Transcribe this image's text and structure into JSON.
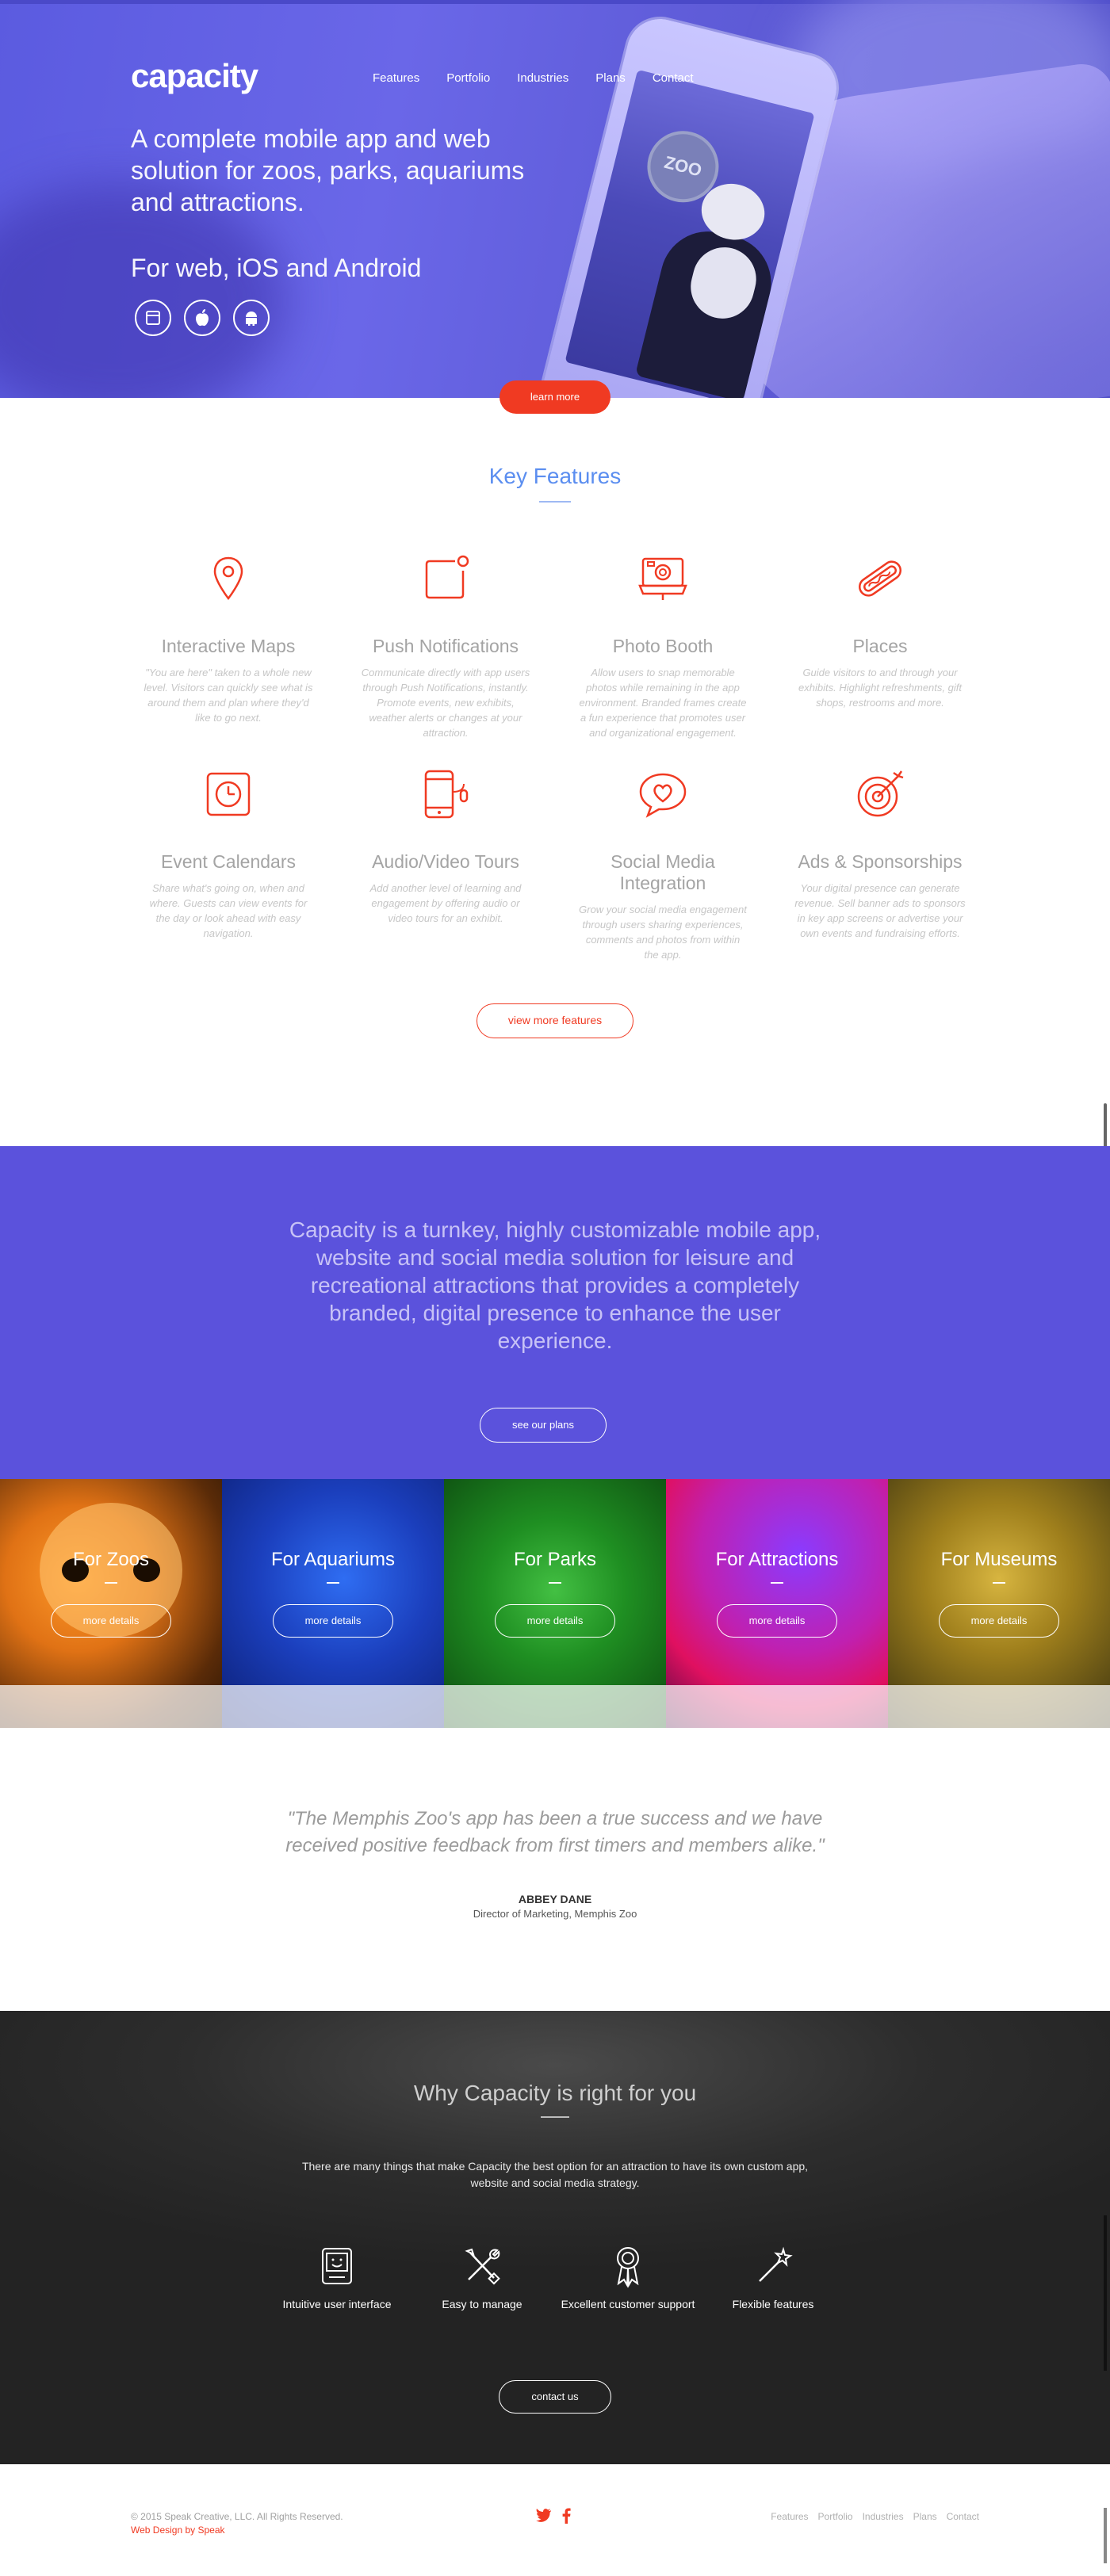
{
  "header": {
    "brand": "capacity",
    "nav": [
      "Features",
      "Portfolio",
      "Industries",
      "Plans",
      "Contact"
    ]
  },
  "hero": {
    "headline": "A complete mobile app and web solution for zoos, parks, aquariums and attractions.",
    "subhead": "For web, iOS and Android",
    "platforms": [
      "browser-icon",
      "apple-icon",
      "android-icon"
    ],
    "phone_badge": "ZOO",
    "cta": "learn more"
  },
  "features": {
    "title": "Key Features",
    "items": [
      {
        "icon": "map-pin-icon",
        "title": "Interactive Maps",
        "desc": "\"You are here\" taken to a whole new level. Visitors can quickly see what is around them and plan where they'd like to go next."
      },
      {
        "icon": "notification-icon",
        "title": "Push Notifications",
        "desc": "Communicate directly with app users through Push Notifications, instantly. Promote events, new exhibits, weather alerts or changes at your attraction."
      },
      {
        "icon": "photo-booth-icon",
        "title": "Photo Booth",
        "desc": "Allow users to snap memorable photos while remaining in the app environment. Branded frames create a fun experience that promotes user and organizational engagement."
      },
      {
        "icon": "hotdog-icon",
        "title": "Places",
        "desc": "Guide visitors to and through your exhibits. Highlight refreshments, gift shops, restrooms and more."
      },
      {
        "icon": "calendar-clock-icon",
        "title": "Event Calendars",
        "desc": "Share what's going on, when and where. Guests can view events for the day or look ahead with easy navigation."
      },
      {
        "icon": "audio-video-icon",
        "title": "Audio/Video Tours",
        "desc": "Add another level of learning and engagement by offering audio or video tours for an exhibit."
      },
      {
        "icon": "heart-bubble-icon",
        "title": "Social Media Integration",
        "desc": "Grow your social media engagement through users sharing experiences, comments and photos from within the app."
      },
      {
        "icon": "target-icon",
        "title": "Ads & Sponsorships",
        "desc": "Your digital presence can generate revenue. Sell banner ads to sponsors in key app screens or advertise your own events and fundraising efforts."
      }
    ],
    "cta": "view more features"
  },
  "statement": {
    "text": "Capacity is a turnkey, highly customizable mobile app, website and social media solution for leisure and recreational attractions that provides a completely branded, digital presence to enhance the user experience.",
    "cta": "see our plans"
  },
  "categories": [
    {
      "title": "For Zoos",
      "button": "more details"
    },
    {
      "title": "For Aquariums",
      "button": "more details"
    },
    {
      "title": "For Parks",
      "button": "more details"
    },
    {
      "title": "For Attractions",
      "button": "more details"
    },
    {
      "title": "For Museums",
      "button": "more details"
    }
  ],
  "testimonial": {
    "quote": "\"The Memphis Zoo's app has been a true success and we have received positive feedback from first timers and members alike.\"",
    "name": "ABBEY DANE",
    "role": "Director of Marketing, Memphis Zoo"
  },
  "why": {
    "title": "Why Capacity is right for you",
    "desc": "There are many things that make Capacity the best option for an attraction to have its own custom app, website and social media strategy.",
    "benefits": [
      {
        "icon": "smiling-screen-icon",
        "label": "Intuitive user interface"
      },
      {
        "icon": "tools-icon",
        "label": "Easy to manage"
      },
      {
        "icon": "award-ribbon-icon",
        "label": "Excellent customer support"
      },
      {
        "icon": "magic-wand-icon",
        "label": "Flexible features"
      }
    ],
    "cta": "contact us"
  },
  "footer": {
    "copyright": "© 2015 Speak Creative, LLC. All Rights Reserved.",
    "credit": "Web Design by Speak",
    "social": [
      "twitter-icon",
      "facebook-icon"
    ],
    "nav": [
      "Features",
      "Portfolio",
      "Industries",
      "Plans",
      "Contact"
    ]
  },
  "colors": {
    "accent": "#f03a22",
    "hero_blue": "#5f5cd8",
    "statement_purple": "#5b52dc",
    "features_title": "#5b8ef0",
    "dark": "#2d2d2d"
  }
}
